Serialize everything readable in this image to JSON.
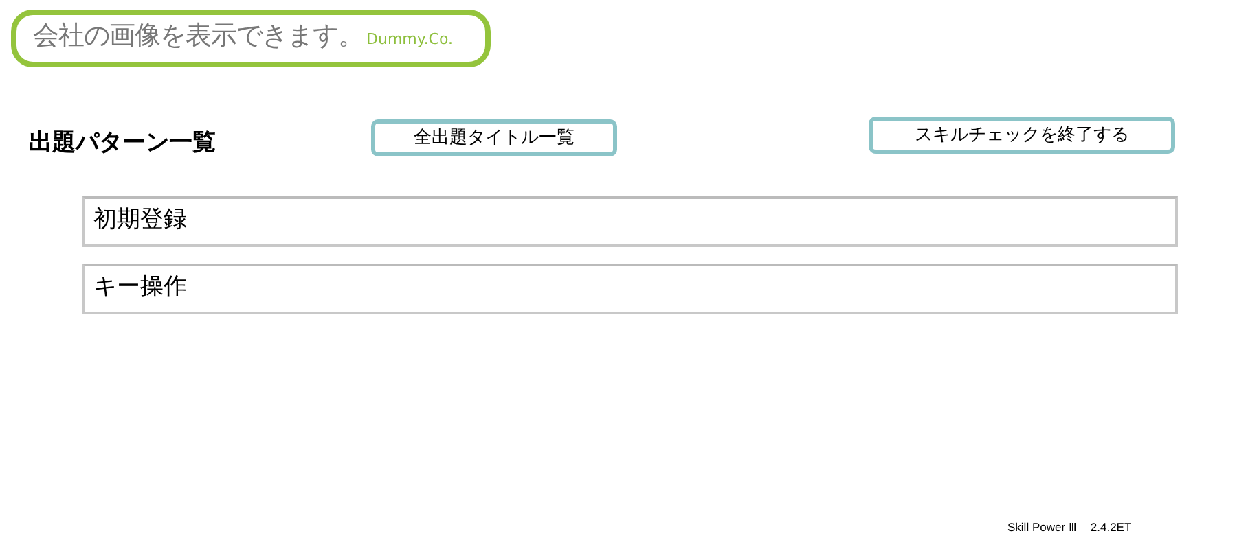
{
  "logo": {
    "text": "会社の画像を表示できます。",
    "company": "Dummy.Co."
  },
  "heading": "出題パターン一覧",
  "buttons": [
    {
      "label": "全出題タイトル一覧"
    },
    {
      "label": "スキルチェックを終了する"
    }
  ],
  "patterns": [
    {
      "label": "初期登録"
    },
    {
      "label": "キー操作"
    }
  ],
  "footer": {
    "product": "Skill Power Ⅲ",
    "version": "2.4.2ET"
  }
}
